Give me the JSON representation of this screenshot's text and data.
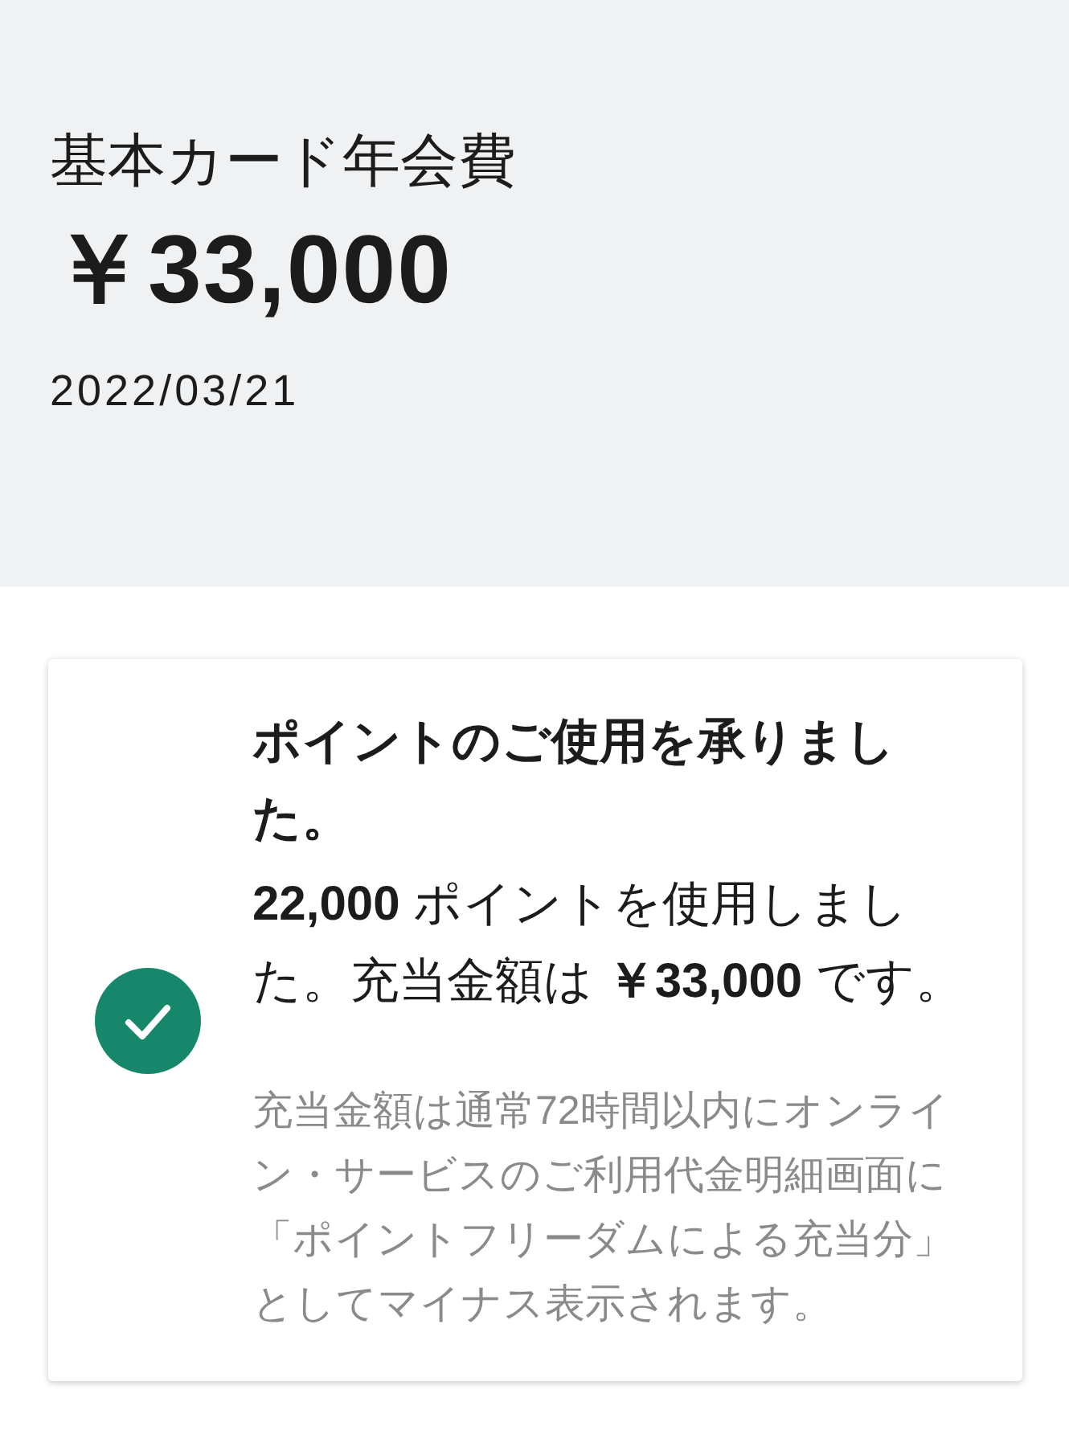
{
  "header": {
    "title": "基本カード年会費",
    "amount": "￥33,000",
    "date": "2022/03/21"
  },
  "notice": {
    "title": "ポイントのご使用を承りました。",
    "message": "**22,000** ポイントを使用しました。充当金額は **￥33,000** です。",
    "note": "充当金額は通常72時間以内にオンライン・サービスのご利用代金明細画面に「ポイントフリーダムによる充当分」としてマイナス表示されます。"
  }
}
